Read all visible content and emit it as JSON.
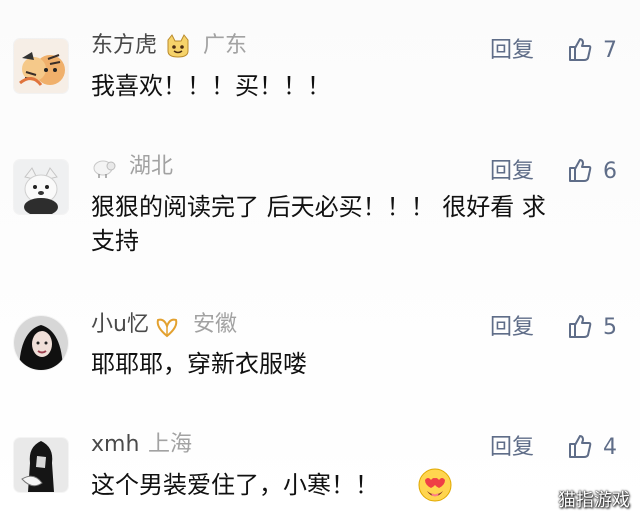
{
  "comments": [
    {
      "username": "东方虎",
      "region": "广东",
      "text": "我喜欢！！！买！！！",
      "reply_label": "回复",
      "likes": "7",
      "avatar_icon": "cartoon-tiger-avatar",
      "badge_icon": "cat-emoji-icon"
    },
    {
      "username": "",
      "region": "湖北",
      "text": "狠狠的阅读完了 后天必买！！！ 很好看 求\n支持",
      "reply_label": "回复",
      "likes": "6",
      "avatar_icon": "white-dog-avatar",
      "badge_icon": "sheep-icon"
    },
    {
      "username": "小u忆",
      "region": "安徽",
      "text": "耶耶耶，穿新衣服喽",
      "reply_label": "回复",
      "likes": "5",
      "avatar_icon": "dark-hair-woman-avatar",
      "badge_icon": "outline-heart-icon"
    },
    {
      "username": "xmh",
      "region": "上海",
      "text": "这个男装爱住了，小寒！！",
      "reply_label": "回复",
      "likes": "4",
      "avatar_icon": "bw-photo-avatar",
      "emoji_icon": "heart-eyes-emoji"
    }
  ],
  "watermark": "猫指游戏",
  "colors": {
    "background": "#ffffff",
    "username": "#4a4a4a",
    "region": "#a2a2a2",
    "body": "#111111",
    "action": "#5f6d88",
    "watermark": "#ffffff"
  }
}
